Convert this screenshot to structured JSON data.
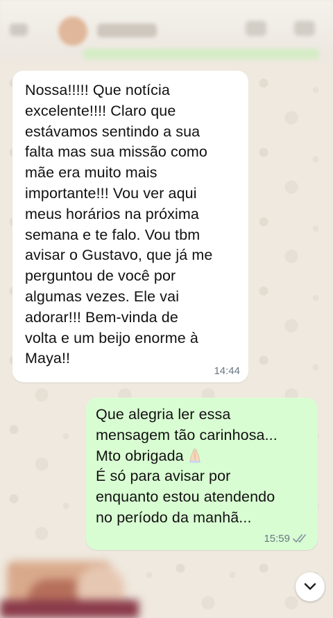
{
  "messages": [
    {
      "direction": "incoming",
      "text": "Nossa!!!!! Que notícia\nexcelente!!!! Claro que\nestávamos sentindo a sua\nfalta mas sua missão como\nmãe era muito mais\nimportante!!!   Vou ver aqui\nmeus horários na próxima\nsemana e te falo.  Vou tbm\navisar o Gustavo, que já me\nperguntou de você por\nalgumas vezes.  Ele vai\nadorar!!!   Bem-vinda de\nvolta e um beijo enorme à\nMaya!!",
      "time": "14:44"
    },
    {
      "direction": "outgoing",
      "text_before_emoji": "Que alegria ler essa\nmensagem tão carinhosa...\nMto obrigada",
      "emoji": "folded-hands",
      "text_after_emoji": "É só para avisar por\nenquanto estou atendendo\nno período da manhã...",
      "time": "15:59",
      "status": "read",
      "status_icon": "double-check-icon"
    }
  ],
  "colors": {
    "incoming_bubble": "#ffffff",
    "outgoing_bubble": "#d9fdd3",
    "chat_background": "#efe9df",
    "timestamp": "#667781"
  },
  "scroll_button": {
    "icon": "chevron-down-icon"
  }
}
